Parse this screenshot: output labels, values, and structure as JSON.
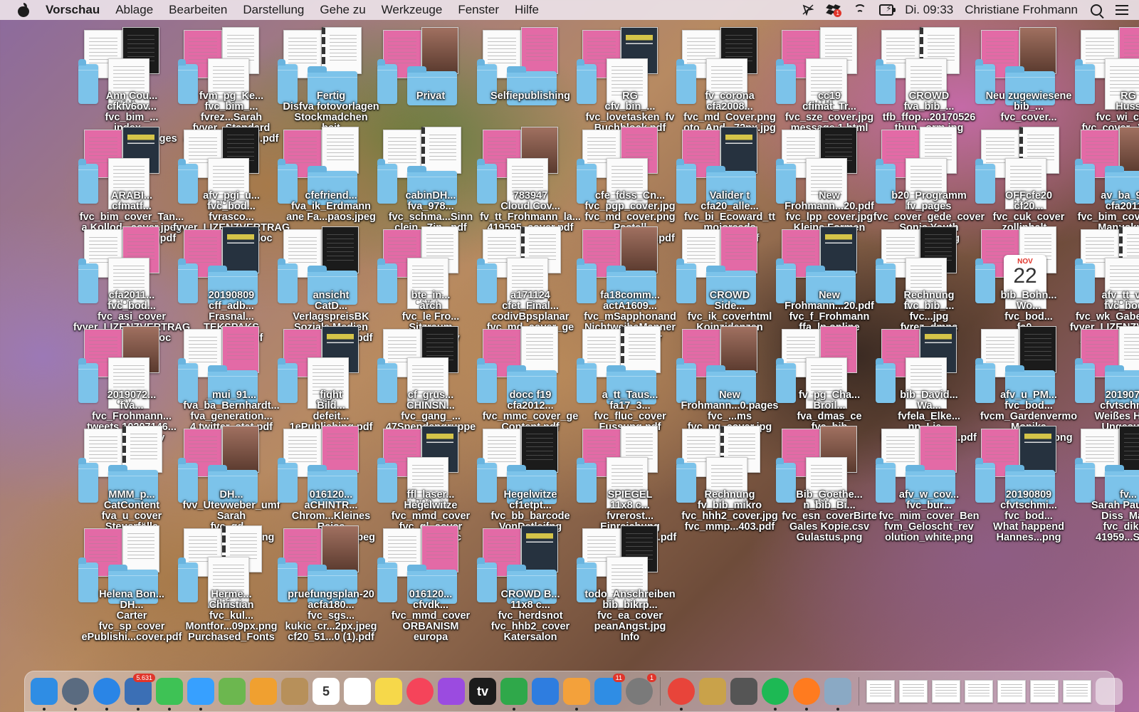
{
  "menubar": {
    "app": "Vorschau",
    "items": [
      "Ablage",
      "Bearbeiten",
      "Darstellung",
      "Gehe zu",
      "Werkzeuge",
      "Fenster",
      "Hilfe"
    ],
    "clock": "Di. 09:33",
    "user": "Christiane Frohmann",
    "status_icons": [
      "cursor-icon",
      "dropbox-icon",
      "wifi-icon",
      "battery-charging-icon",
      "search-icon",
      "control-center-icon"
    ],
    "dropbox_badge": "1"
  },
  "desktop": {
    "icons": [
      {
        "kind": "doc",
        "label": [
          "Ann Cou...",
          "cfkfv6ov...",
          "fvc_bim_...",
          "index...",
          "rtrag 20...13.pages"
        ],
        "tag": "HTML"
      },
      {
        "kind": "doc",
        "label": [
          "fvm_pg_Ke...",
          "fvc_bim_...",
          "fvrez...Sarah",
          "fvver...Standard",
          "ag Froh...assen.pdf"
        ]
      },
      {
        "kind": "folder",
        "label": [
          "Fertig",
          "Disfva fotovorlagen",
          "Stockmadchen",
          "beit"
        ]
      },
      {
        "kind": "folder",
        "label": [
          "Privat"
        ]
      },
      {
        "kind": "folder",
        "label": [
          "Selfiepublishing"
        ]
      },
      {
        "kind": "doc",
        "label": [
          "RG",
          "cfv_bin_...",
          "fvc_lovetasken_fv",
          "Buchblock.pdf"
        ]
      },
      {
        "kind": "doc",
        "label": [
          "fv_corona",
          "cfa2008...",
          "fvc_md_Cover.png",
          "oto_And...72px.jpg"
        ]
      },
      {
        "kind": "doc",
        "label": [
          "cc19",
          "cfimat_Tr...",
          "fvc_sze_cover.jpg",
          "message 1.html"
        ],
        "tag": "HTML"
      },
      {
        "kind": "doc",
        "label": [
          "CROWD",
          "fva_bib_...",
          "tfb_ffop...20170526",
          "thun...orm.jpg"
        ]
      },
      {
        "kind": "folder",
        "label": [
          "Neu zugewiesene",
          "bib_...",
          "fvc_cover..."
        ]
      },
      {
        "kind": "doc",
        "label": [
          "RG",
          "Huss",
          "fvc_wi_cover",
          "fvc_cover...Vorlage"
        ]
      },
      {
        "kind": "doc",
        "label": [
          "ARABI...",
          "cfmatf...",
          "fvc_bim_cover_Tan...",
          "a Kollod...cover.jpeg",
          "Wagner...INAL.pdf"
        ]
      },
      {
        "kind": "doc",
        "label": [
          "afv_pgi_u...",
          "fvc_bod...",
          "fvrasco...",
          "fvver_LIZENZVERTRAG",
          "Roman...697.doc"
        ],
        "tag": "DOC"
      },
      {
        "kind": "folder",
        "label": [
          "cfefriend...",
          "fva_ik_Erdmann",
          "ane Fa...paos.jpeg"
        ]
      },
      {
        "kind": "folder",
        "label": [
          "cabinDH...",
          "fva_978...",
          "fvc_schma...Sinn",
          "clein...Zin...pdf"
        ]
      },
      {
        "kind": "doc",
        "label": [
          "783947",
          "Cloud Cov...",
          "fv_tt_Frohmann_la...",
          "419595_cover.pdf"
        ]
      },
      {
        "kind": "doc",
        "label": [
          "cfe_fdss_Cn...",
          "fvc_pgp_cover.jpg",
          "fvc_md_cover.png",
          "Pastell",
          "perator...abahl.pdf"
        ]
      },
      {
        "kind": "folder",
        "label": [
          "Valider t",
          "cfa20_alle...",
          "fvc_bi_Ecoward_tt",
          "mojoreads",
          "ftz_Kat...pdf"
        ]
      },
      {
        "kind": "doc",
        "label": [
          "New",
          "Frohmann...20.pdf",
          "fvc_lpp_cover.jpg",
          "Kleine Formen"
        ]
      },
      {
        "kind": "doc",
        "label": [
          "b20_Programm",
          "fv_pages",
          "fvc_cover_gede_cover",
          "Sonic Youth",
          "Topshop.jpg"
        ]
      },
      {
        "kind": "doc",
        "label": [
          "OFFcfe20",
          "cf20...",
          "fvc_cuk_cover",
          "zollinhalt...",
          "bn_cn_22"
        ],
        "tag": "PDF"
      },
      {
        "kind": "folder",
        "label": [
          "av_ba_97...",
          "cfa2011...",
          "fvc_bim_cover_Berg",
          "Manuskripte"
        ]
      },
      {
        "kind": "doc",
        "label": [
          "cfa2011...",
          "fvc_bod...",
          "fvc_asi_cover",
          "fvver_LIZENZVERTRAG",
          "Steffi...3515.doc"
        ],
        "tag": "DOC"
      },
      {
        "kind": "folder",
        "label": [
          "20190809",
          "cff_adb...",
          "Frasnal...",
          "TEKSPAKS",
          "wel...ung.pdf"
        ]
      },
      {
        "kind": "folder",
        "label": [
          "ansicht",
          "CatD...",
          "VerlagspreisBK",
          "Soziale Medien",
          "41959...cover.pdf"
        ]
      },
      {
        "kind": "doc",
        "label": [
          "bte_in...",
          "arch",
          "fvc_le Fro...",
          "Sitzraum",
          "salesp1.csv"
        ],
        "tag": "CSV"
      },
      {
        "kind": "doc",
        "label": [
          "a171124",
          "cfet_Final...",
          "codivBpsplanar",
          "fvc_md_cover_ge",
          "Photocase"
        ]
      },
      {
        "kind": "folder",
        "label": [
          "fa18comm...",
          "actA1609...",
          "fvc_mSapphonand",
          "NichtweibeManner",
          "fvc_rk_cover"
        ]
      },
      {
        "kind": "folder",
        "label": [
          "CROWD",
          "Side...",
          "fvc_ik_coverhtml",
          "Koinzidenzen",
          "ett...jpg"
        ]
      },
      {
        "kind": "folder",
        "label": [
          "New",
          "Frohmann...20.pdf",
          "fvc_f_Frohmann",
          "ffa_lp online"
        ]
      },
      {
        "kind": "doc",
        "label": [
          "Rechnung",
          "fvc_bib_...",
          "fvc...jpg",
          "fvrez_dmns"
        ]
      },
      {
        "kind": "doc",
        "label": [
          "bib_Bohn...",
          "Wo...",
          "fvc_bod...",
          "fa0...",
          "2761.ics"
        ],
        "cal": {
          "m": "NOV",
          "d": "22"
        }
      },
      {
        "kind": "doc",
        "label": [
          "afv_tt_v1...",
          "fvc_bod...",
          "fvc_wk_Gaber_ham...",
          "fvver_LIZENZVERTRAG",
          "_Ute_We...7897.doc"
        ],
        "tag": "DOC"
      },
      {
        "kind": "doc",
        "label": [
          "2019072...",
          "fva...",
          "fvc_Frohmann...",
          "tweets 10207146...",
          "07958778.csv"
        ],
        "tag": "CSV"
      },
      {
        "kind": "folder",
        "label": [
          "_mui_91...",
          "fva_ba_Bernhardt...",
          "fva_generation...",
          "4 twitter_stat.pdf"
        ]
      },
      {
        "kind": "doc",
        "label": [
          "fight",
          "Bild...",
          "defeit...",
          "1ePublishing.pdf"
        ],
        "tag": "CSV"
      },
      {
        "kind": "doc",
        "label": [
          "cf_grus...",
          "CHINSN...",
          "fvc_gang_...",
          "47Spendengruppe"
        ]
      },
      {
        "kind": "folder",
        "label": [
          "docc f19",
          "cfa2012...",
          "fvc_mmc_cover_ge",
          "Content.pdf"
        ]
      },
      {
        "kind": "folder",
        "label": [
          "a_tt_Taus...",
          "fa17_3...",
          "fvc_fluc_cover",
          "Fussung.pdf"
        ]
      },
      {
        "kind": "folder",
        "label": [
          "New",
          "Frohmann...0.pages",
          "fvc_...ms",
          "fvc_pg_cover.jpg"
        ]
      },
      {
        "kind": "doc",
        "label": [
          "fv_pg_Cha...",
          "Broil...",
          "fva_dmas_ce",
          "fvc_bib"
        ]
      },
      {
        "kind": "doc",
        "label": [
          "bib_David...",
          "Wa...",
          "fvfela_Elke...",
          "nn_Lie...",
          "Rinck_to...INAL.pdf"
        ]
      },
      {
        "kind": "folder",
        "label": [
          "afv_u_PM...",
          "fvc_bod...",
          "fvcm_Gardenvermo",
          "Monika",
          "tiv_Marl...nite.png"
        ]
      },
      {
        "kind": "folder",
        "label": [
          "20190723",
          "cfvtschmi...",
          "Weißes Hemd",
          "Ungesucht",
          "Weber.png"
        ]
      },
      {
        "kind": "folder",
        "label": [
          "MMM_p...",
          "CatContent",
          "fva_u_cover",
          "Steuerfälle",
          "fvc_tt...jpg"
        ]
      },
      {
        "kind": "folder",
        "label": [
          "DH...",
          "fvv_Utevweber_umf",
          "Sarah",
          "fvc_gd...",
          "1ePublishing.png"
        ]
      },
      {
        "kind": "folder",
        "label": [
          "016120...",
          "aCHINTR...",
          "Chrom...Kleines",
          "Reise",
          "Montfor...2px.jpeg"
        ]
      },
      {
        "kind": "doc",
        "label": [
          "ffl_laser...",
          "Hegelwitze",
          "fvc_mmd_cover",
          "fvc_gl_cover",
          "e 1...498.doc"
        ],
        "tag": "DOC"
      },
      {
        "kind": "folder",
        "label": [
          "Hegelwitze",
          "cf1etpt...",
          "fvc_bb_barcode",
          "VonDetleifng",
          "fvc_ffr...jpg"
        ]
      },
      {
        "kind": "doc",
        "label": [
          "SPIEGEL",
          "11x8 c...",
          "fvrerost...",
          "Einreichung",
          "den Rob...posé.pdf"
        ]
      },
      {
        "kind": "doc",
        "label": [
          "Rechnung",
          "fv_bib_mikro",
          "fvc_hhh2_cover.jpg",
          "fvc_mmp...403.pdf"
        ]
      },
      {
        "kind": "doc",
        "label": [
          "Bib_Goethe...",
          "n_bib_Bi...",
          "fvc_esn_coverBirte",
          "Gales Kopie.csv",
          "Gulastus.png"
        ],
        "tag": "CSV"
      },
      {
        "kind": "folder",
        "label": [
          "afv_w_cov...",
          "fvc_bur...",
          "fvc_mim_cover_Ben",
          "fvm_Geloscht_rev",
          "olution_white.png"
        ]
      },
      {
        "kind": "folder",
        "label": [
          "20190809",
          "cfvtschmi...",
          "fvc_bod...",
          "What happend",
          "Hannes...png"
        ]
      },
      {
        "kind": "folder",
        "label": [
          "fv...",
          "Sarah Paulso...",
          "Diss_Mat...",
          "fvc_dikb...",
          "41959...Stock"
        ]
      },
      {
        "kind": "folder",
        "label": [
          "Helena Bon...",
          "DH...",
          "Carter",
          "fvc_sp_cover",
          "ePublishi...cover.pdf"
        ]
      },
      {
        "kind": "doc",
        "label": [
          "Herme...",
          "Christian",
          "fvc_kul...",
          "Montfor...09px.png",
          "Purchased_Fonts"
        ],
        "tag": "PDF"
      },
      {
        "kind": "folder",
        "label": [
          "pruefungsplan-20",
          "acfa180...",
          "fvc_sgs...",
          "kukic_cr...2px.jpeg",
          "cf20_51...0 (1).pdf"
        ]
      },
      {
        "kind": "folder",
        "label": [
          "016120...",
          "cfvdk...",
          "fvc_mmd_cover",
          "ORBANISM",
          "europa"
        ]
      },
      {
        "kind": "folder",
        "label": [
          "CROWD B...",
          "11x8 c...",
          "fvc_herdsnot",
          "fvc_hhb2_cover",
          "Katersalon"
        ]
      },
      {
        "kind": "doc",
        "label": [
          "todo_Anschreiben",
          "bib_bikrp...",
          "fvc_ea_cover",
          "peanAngst.jpg",
          "Info"
        ]
      }
    ]
  },
  "dock": {
    "apps": [
      {
        "name": "finder-icon",
        "color": "#2f8de4"
      },
      {
        "name": "launchpad-icon",
        "color": "#5a6b80"
      },
      {
        "name": "safari-icon",
        "color": "#2a85e6"
      },
      {
        "name": "calendar-stack-icon",
        "color": "#3b6fb5",
        "badge": "5.631"
      },
      {
        "name": "facetime-icon",
        "color": "#3ec255"
      },
      {
        "name": "messages-icon",
        "color": "#37a0ff"
      },
      {
        "name": "maps-icon",
        "color": "#6cb74f"
      },
      {
        "name": "photos-icon",
        "color": "#f0a030"
      },
      {
        "name": "contacts-icon",
        "color": "#b7905a"
      },
      {
        "name": "calendar-icon",
        "color": "#ffffff",
        "label": "5"
      },
      {
        "name": "reminders-icon",
        "color": "#ffffff"
      },
      {
        "name": "notes-icon",
        "color": "#f6d84a"
      },
      {
        "name": "music-icon",
        "color": "#f5445a"
      },
      {
        "name": "podcasts-icon",
        "color": "#9b4be0"
      },
      {
        "name": "tv-icon",
        "color": "#1b1b1b",
        "label": "tv"
      },
      {
        "name": "numbers-icon",
        "color": "#2fa84a"
      },
      {
        "name": "keynote-icon",
        "color": "#2e7de0"
      },
      {
        "name": "pages-icon",
        "color": "#f3a13b"
      },
      {
        "name": "app-store-icon",
        "color": "#2f8de4",
        "badge": "11"
      },
      {
        "name": "system-preferences-icon",
        "color": "#7a7a7a",
        "badge": "1"
      },
      {
        "name": "chrome-icon",
        "color": "#e8443a"
      },
      {
        "name": "keychain-icon",
        "color": "#c9a24a"
      },
      {
        "name": "scanner-icon",
        "color": "#555555"
      },
      {
        "name": "spotify-icon",
        "color": "#1db954"
      },
      {
        "name": "firefox-icon",
        "color": "#ff7b1f"
      },
      {
        "name": "preview-icon",
        "color": "#8aa9c4"
      }
    ]
  }
}
